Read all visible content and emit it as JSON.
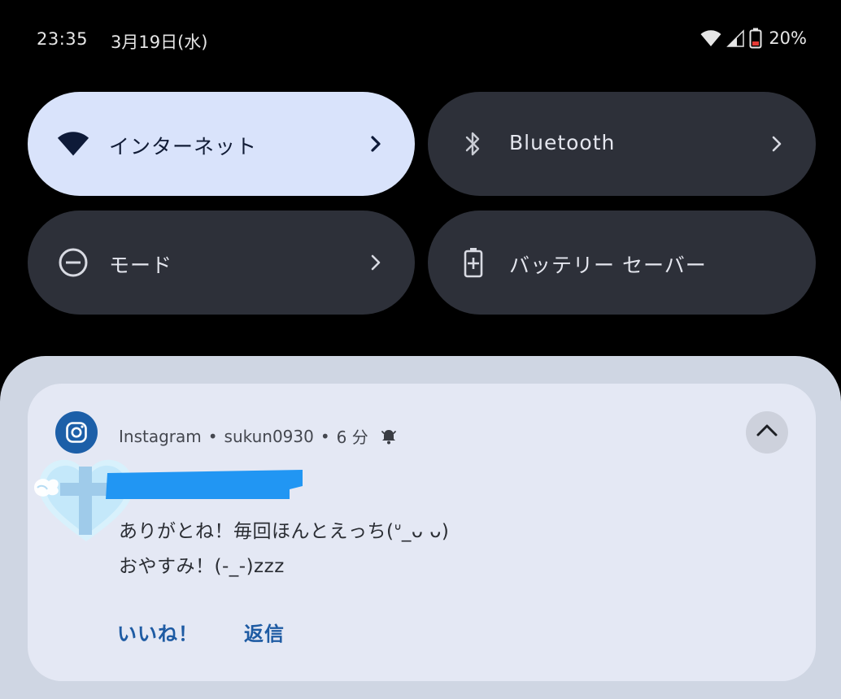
{
  "status_bar": {
    "time": "23:35",
    "date": "3月19日(水)",
    "battery_percent": "20%",
    "icons": [
      "wifi-icon",
      "cell-signal-icon",
      "battery-low-icon"
    ]
  },
  "quick_settings": {
    "tiles": [
      {
        "label": "インターネット",
        "icon": "wifi-icon",
        "active": true,
        "has_chevron": true
      },
      {
        "label": "Bluetooth",
        "icon": "bluetooth-icon",
        "active": false,
        "has_chevron": true
      },
      {
        "label": "モード",
        "icon": "do-not-disturb-icon",
        "active": false,
        "has_chevron": true
      },
      {
        "label": "バッテリー セーバー",
        "icon": "battery-saver-icon",
        "active": false,
        "has_chevron": false
      }
    ]
  },
  "notification": {
    "app_name": "Instagram",
    "separator": "•",
    "account": "sukun0930",
    "age": "6 分",
    "app_icon": "instagram-icon",
    "alert_icon": "bell-icon",
    "expand_icon": "chevron-up-icon",
    "message_lines": [
      "ありがとね！毎回ほんとえっち(ᐡ_ᴗ ᴗ)",
      "おやすみ！(-_-)zzz"
    ],
    "actions": [
      {
        "label": "いいね！"
      },
      {
        "label": "返信"
      }
    ]
  },
  "colors": {
    "background": "#000000",
    "tile_dark": "#2d3039",
    "tile_active": "#d9e3fb",
    "shade": "#cfd6e3",
    "card": "#e4e8f4",
    "action_text": "#1e5ba3",
    "redaction": "#2196f3"
  }
}
